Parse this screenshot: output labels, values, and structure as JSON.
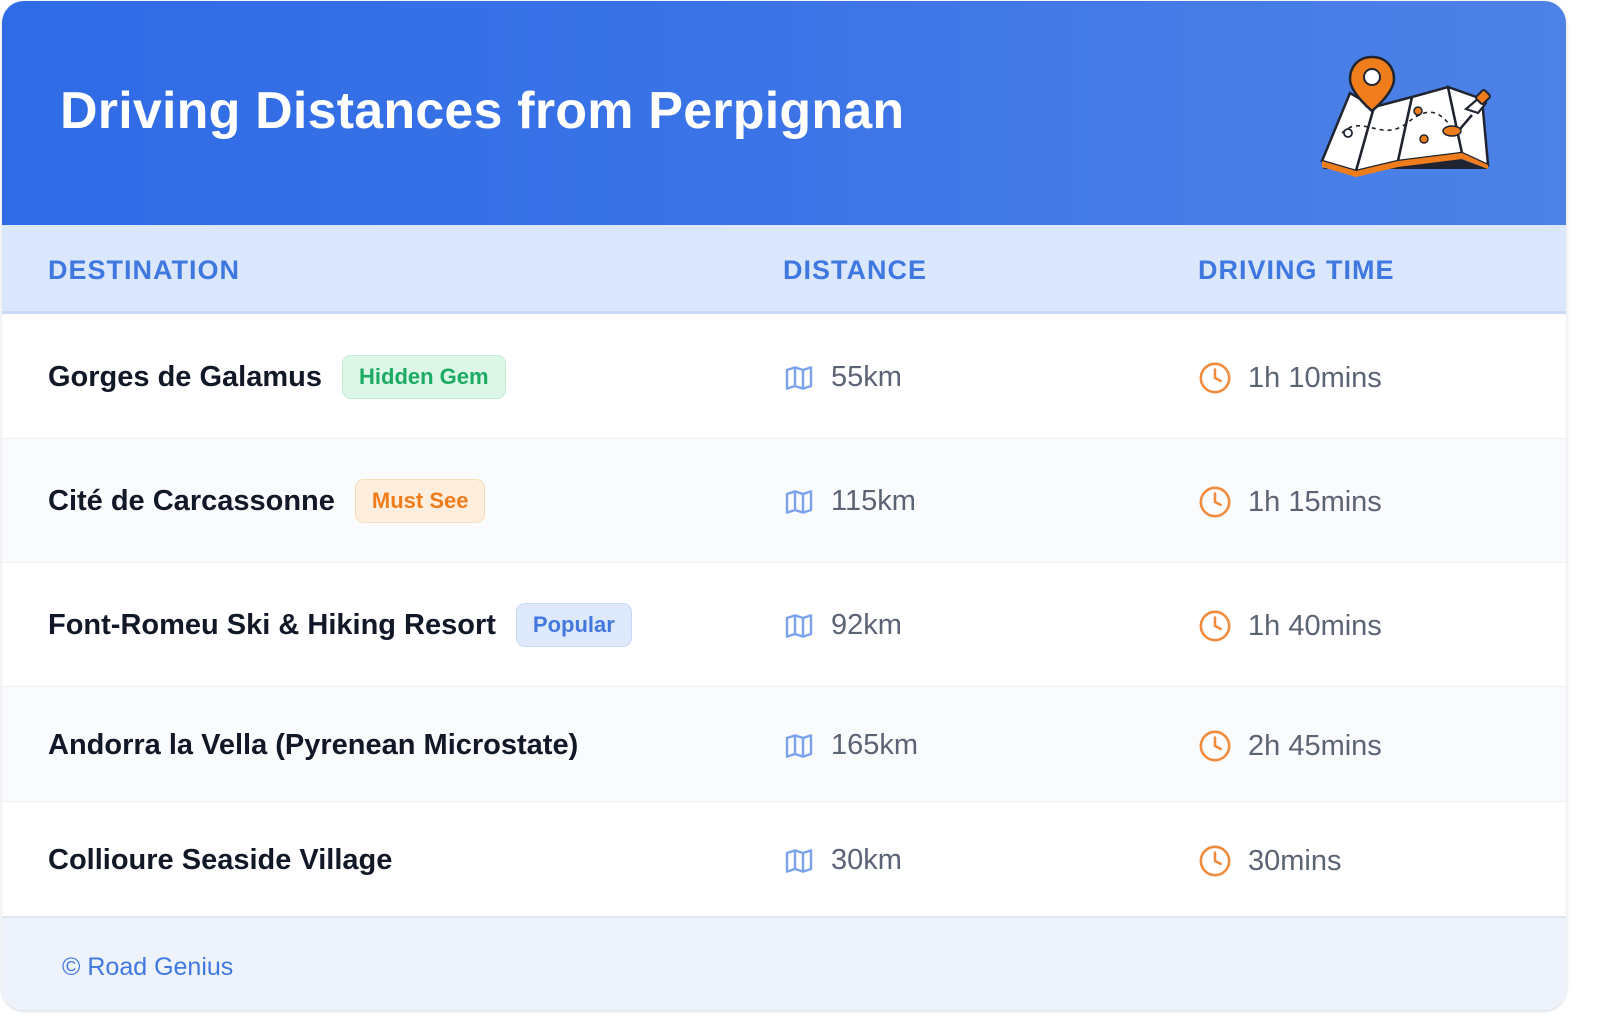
{
  "header": {
    "title": "Driving Distances from Perpignan",
    "illustration_icon": "map-with-location-pin-icon"
  },
  "table": {
    "columns": [
      "DESTINATION",
      "DISTANCE",
      "DRIVING TIME"
    ],
    "rows": [
      {
        "destination": "Gorges de Galamus",
        "badge": "Hidden Gem",
        "badge_style": "green",
        "distance": "55km",
        "time": "1h 10mins"
      },
      {
        "destination": "Cité de Carcassonne",
        "badge": "Must See",
        "badge_style": "orange",
        "distance": "115km",
        "time": "1h 15mins"
      },
      {
        "destination": "Font-Romeu Ski & Hiking Resort",
        "badge": "Popular",
        "badge_style": "blue",
        "distance": "92km",
        "time": "1h 40mins"
      },
      {
        "destination": "Andorra la Vella (Pyrenean Microstate)",
        "badge": "",
        "badge_style": "",
        "distance": "165km",
        "time": "2h 45mins"
      },
      {
        "destination": "Collioure Seaside Village",
        "badge": "",
        "badge_style": "",
        "distance": "30km",
        "time": "30mins"
      }
    ],
    "distance_icon": "map-icon",
    "time_icon": "clock-icon"
  },
  "footer": {
    "credit": "© Road Genius"
  },
  "colors": {
    "header_gradient_start": "#2f6be6",
    "header_gradient_end": "#4d82e6",
    "accent_blue": "#3f78e0",
    "accent_orange": "#f08a3c",
    "text_dark": "#111827",
    "text_muted": "#5b6475"
  }
}
